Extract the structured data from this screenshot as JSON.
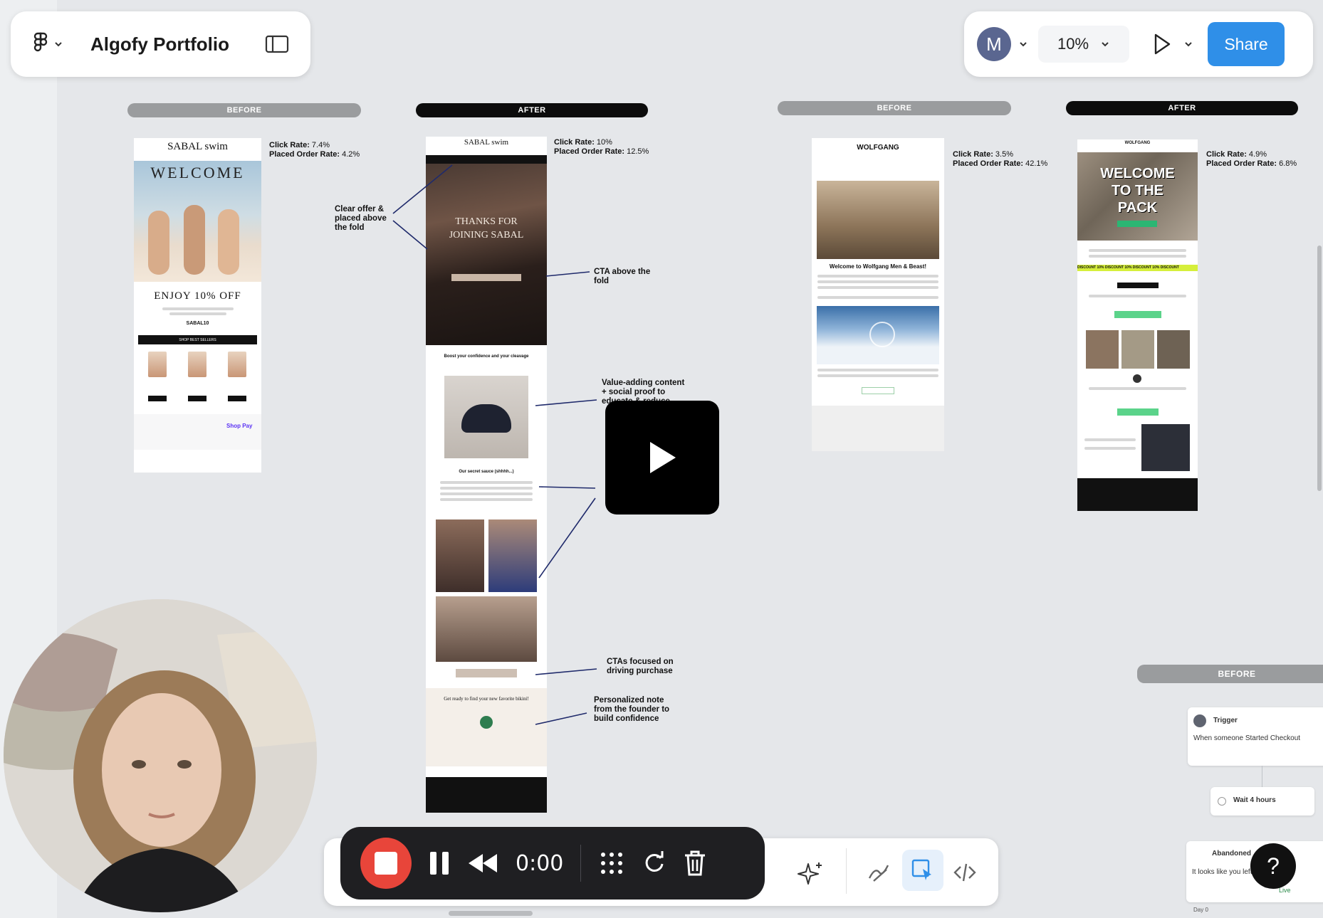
{
  "app": {
    "title": "Algofy Portfolio",
    "zoom": "10%",
    "share_label": "Share",
    "avatar_initial": "M",
    "accent": "#2f8fe8",
    "icons": [
      "figma-logo-icon",
      "panel-toggle-icon",
      "chevron-down-icon",
      "play-icon"
    ]
  },
  "board": {
    "before_label": "BEFORE",
    "after_label": "AFTER",
    "click_rate_label": "Click Rate:",
    "placed_order_label": "Placed Order Rate:",
    "sabal_before": {
      "click": "7.4%",
      "order": "4.2%"
    },
    "sabal_after": {
      "click": "10%",
      "order": "12.5%"
    },
    "wolfgang_before": {
      "click": "3.5%",
      "order": "42.1%"
    },
    "wolfgang_after": {
      "click": "4.9%",
      "order": "6.8%"
    },
    "notes": {
      "clear_offer": "Clear offer & placed above the fold",
      "cta_above": "CTA above the fold",
      "value_adding": "Value-adding content + social proof to educate & reduce",
      "ctas_purchase": "CTAs focused on driving purchase",
      "personalized": "Personalized note from the founder to build confidence"
    }
  },
  "emails": {
    "sabal_before": {
      "brand": "SABAL swim",
      "headline": "WELCOME",
      "offer": "ENJOY 10% OFF",
      "code": "SABAL10",
      "cta": "SHOP BEST SELLERS",
      "buy": "Buy Now",
      "shop": "Shop Pay"
    },
    "sabal_after": {
      "brand": "SABAL swim",
      "hero_text": "THANKS FOR JOINING SABAL",
      "section1": "Boost your confidence and your cleavage",
      "section2": "Our secret sauce (shhhh...)",
      "section3": "Get ready to find your new favorite bikini!"
    },
    "wolfgang_before": {
      "brand": "WOLFGANG",
      "headline": "Welcome to Wolfgang Men & Beast!"
    },
    "wolfgang_after": {
      "brand": "WOLFGANG",
      "headline": "WELCOME TO THE PACK",
      "discount": "DISCOUNT 10% DISCOUNT 10% DISCOUNT 10% DISCOUNT"
    }
  },
  "flow": {
    "trigger_label": "Trigger",
    "trigger_desc": "When someone Started Checkout",
    "wait_label": "Wait 4 hours",
    "abandoned_label": "Abandoned",
    "abandoned_desc": "It looks like you left...",
    "live_label": "Live",
    "day_label": "Day 0"
  },
  "recorder": {
    "time": "0:00",
    "stop_color": "#e8453a"
  },
  "help_label": "?"
}
